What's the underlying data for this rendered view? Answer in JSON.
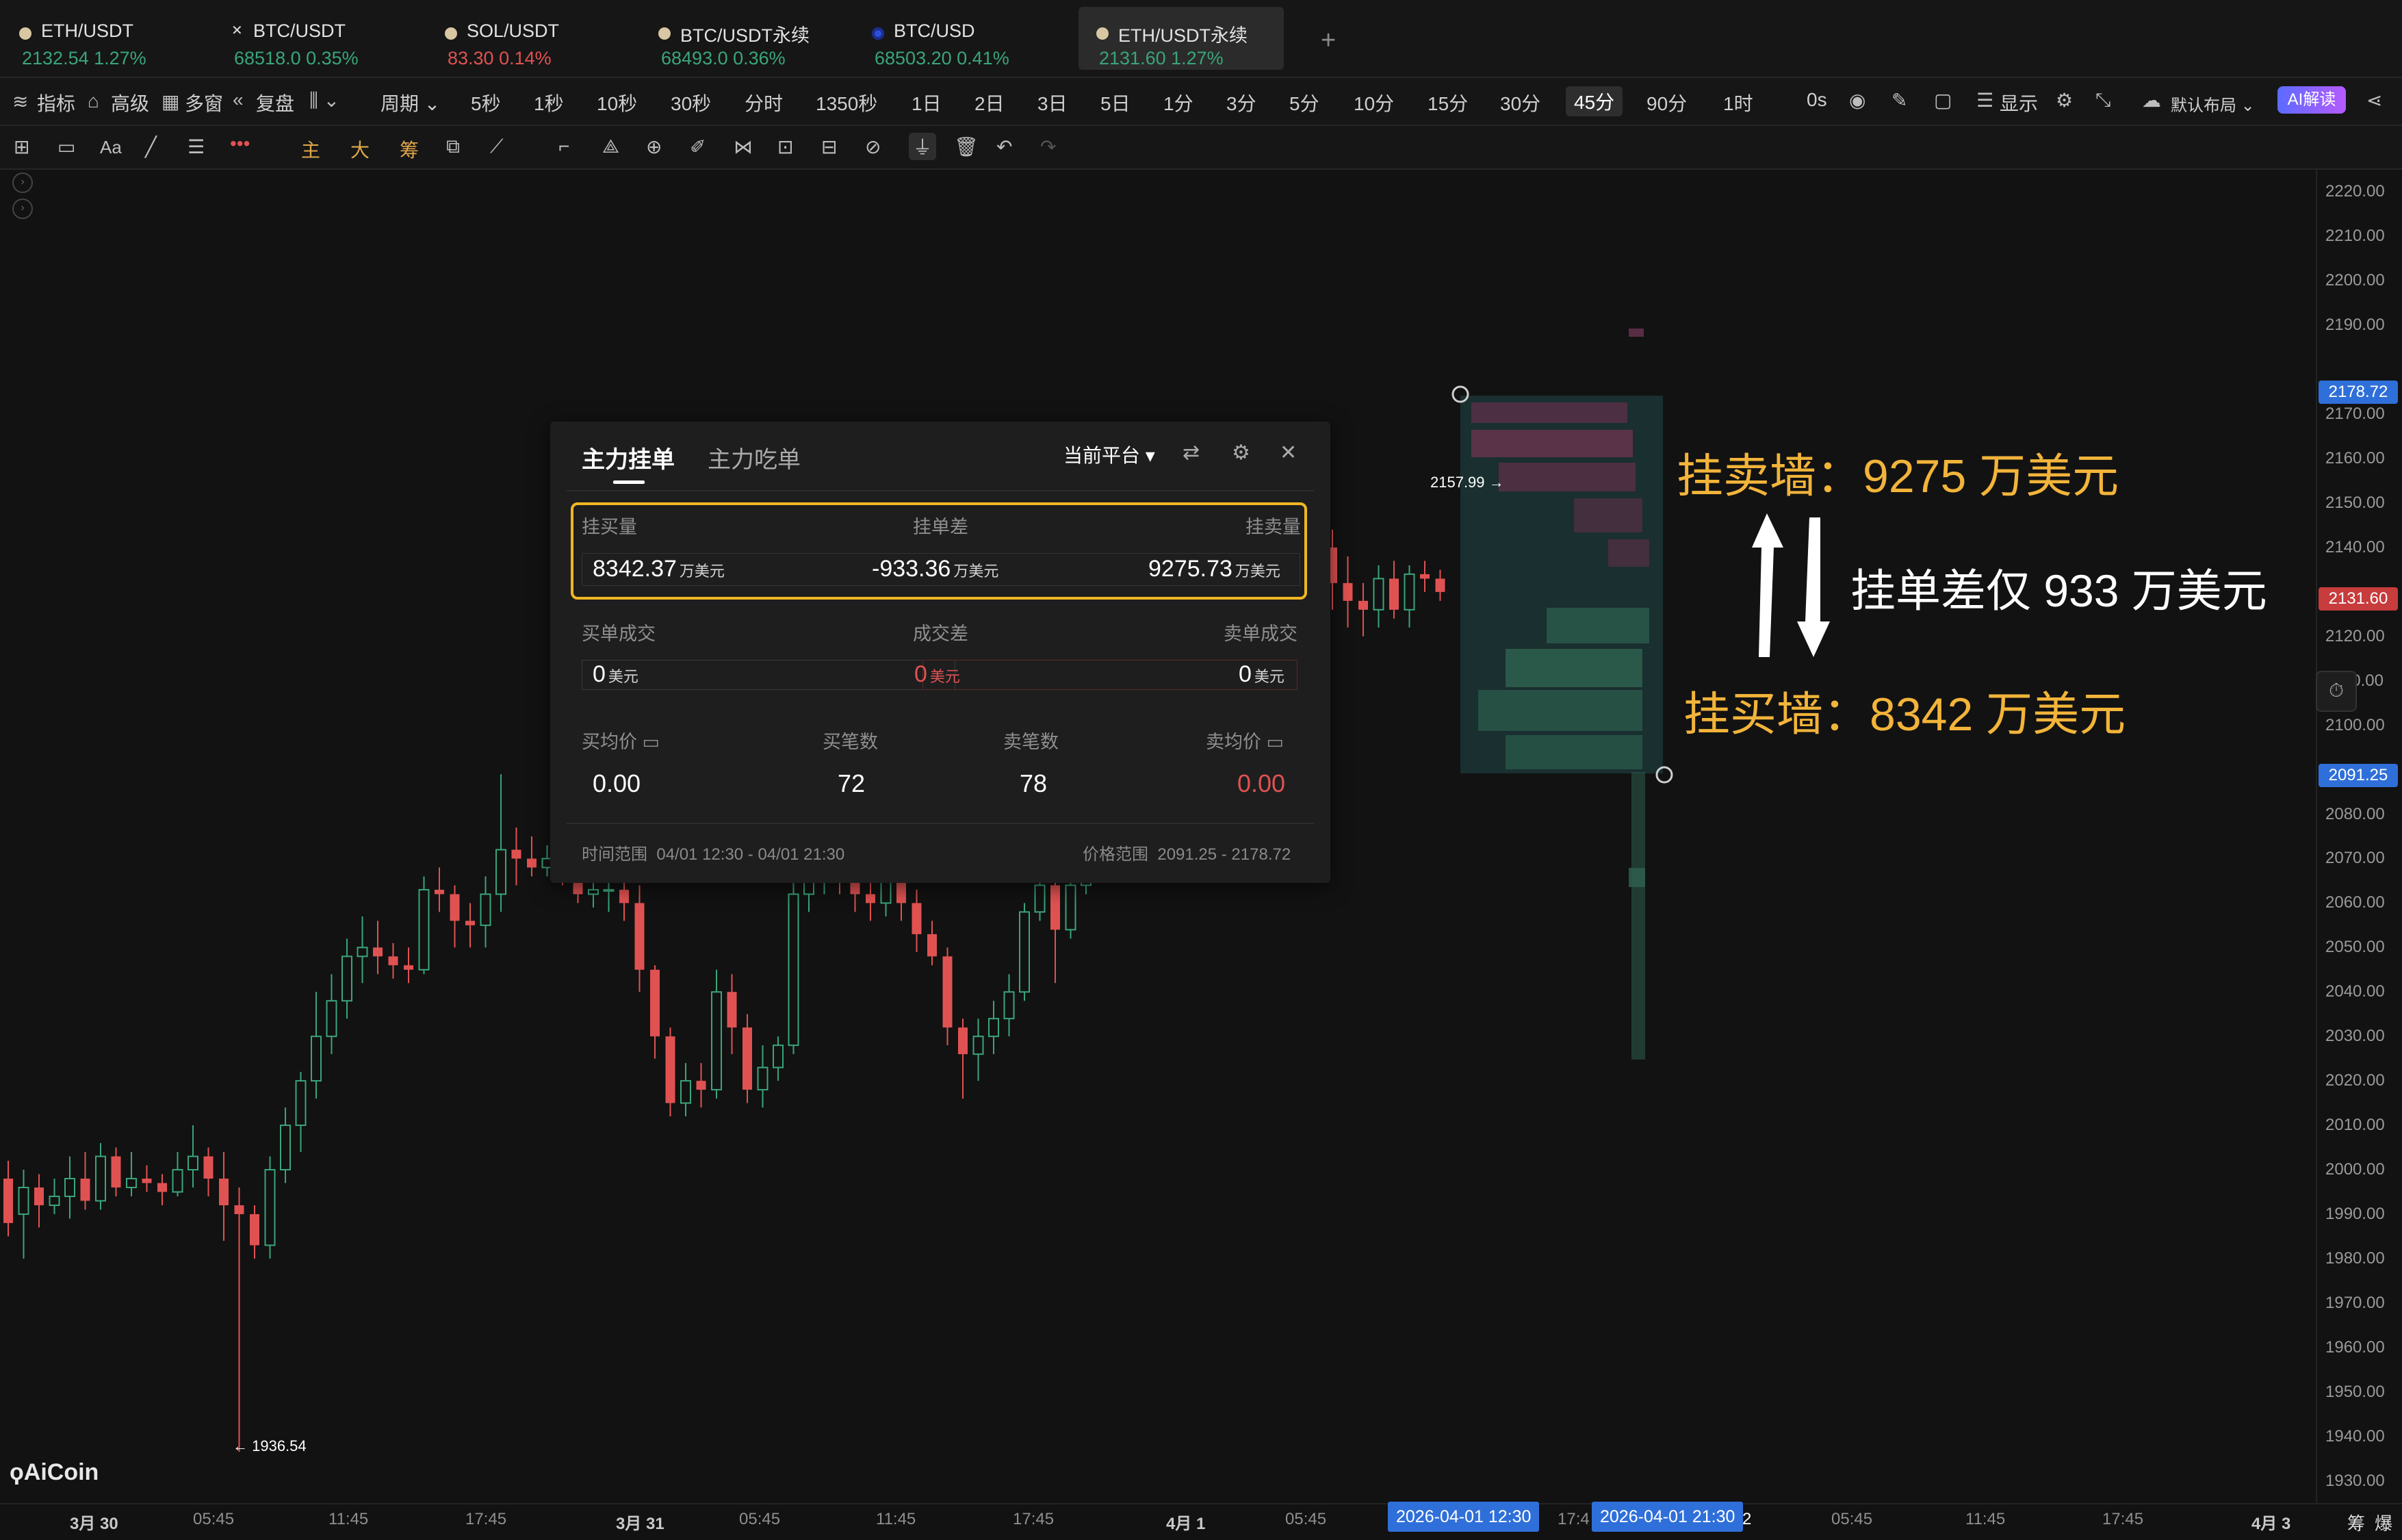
{
  "tabs": [
    {
      "name": "ETH/USDT",
      "price": "2132.54",
      "change": "1.27%",
      "dir": "up"
    },
    {
      "name": "BTC/USDT",
      "price": "68518.0",
      "change": "0.35%",
      "dir": "up"
    },
    {
      "name": "SOL/USDT",
      "price": "83.30",
      "change": "0.14%",
      "dir": "down"
    },
    {
      "name": "BTC/USDT永续",
      "price": "68493.0",
      "change": "0.36%",
      "dir": "up"
    },
    {
      "name": "BTC/USD",
      "price": "68503.20",
      "change": "0.41%",
      "dir": "up"
    },
    {
      "name": "ETH/USDT永续",
      "price": "2131.60",
      "change": "1.27%",
      "dir": "up"
    }
  ],
  "toolbar1": {
    "indicators": "指标",
    "advanced": "高级",
    "multi_window": "多窗",
    "replay": "复盘",
    "period": "周期",
    "intervals": [
      "5秒",
      "1秒",
      "10秒",
      "30秒",
      "分时",
      "1350秒",
      "1日",
      "2日",
      "3日",
      "5日",
      "1分",
      "3分",
      "5分",
      "10分",
      "15分",
      "30分",
      "45分",
      "90分",
      "1时"
    ],
    "selected_interval": "45分",
    "countdown": "0s",
    "display": "显示",
    "layout": "默认布局",
    "ai": "AI解读"
  },
  "toolbar2": {
    "text_aa": "Aa",
    "main": "主",
    "big": "大",
    "chip": "筹"
  },
  "panel": {
    "tab_orders": "主力挂单",
    "tab_eaten": "主力吃单",
    "platform": "当前平台",
    "bid_volume_label": "挂买量",
    "diff_label": "挂单差",
    "ask_volume_label": "挂卖量",
    "bid_volume": "8342.37",
    "diff": "-933.36",
    "ask_volume": "9275.73",
    "unit_wan": "万美元",
    "buy_fill_label": "买单成交",
    "fill_diff_label": "成交差",
    "sell_fill_label": "卖单成交",
    "buy_fill": "0",
    "fill_diff": "0",
    "sell_fill": "0",
    "unit_usd": "美元",
    "buy_avg_label": "买均价",
    "buy_count_label": "买笔数",
    "sell_count_label": "卖笔数",
    "sell_avg_label": "卖均价",
    "buy_avg": "0.00",
    "buy_count": "72",
    "sell_count": "78",
    "sell_avg": "0.00",
    "time_range_label": "时间范围",
    "time_range": "04/01 12:30 - 04/01 21:30",
    "price_range_label": "价格范围",
    "price_range": "2091.25 - 2178.72"
  },
  "annotations": {
    "sell_wall": "挂卖墙：9275 万美元",
    "diff_note": "挂单差仅 933 万美元",
    "buy_wall": "挂买墙：8342 万美元"
  },
  "chart_marks": {
    "high_marker": "2157.99 →",
    "low_marker": "← 1936.54",
    "logo": "AiCoin"
  },
  "price_axis": {
    "labels": [
      "2220.00",
      "2210.00",
      "2200.00",
      "2190.00",
      "2170.00",
      "2160.00",
      "2150.00",
      "2140.00",
      "2120.00",
      "2110.00",
      "2100.00",
      "2080.00",
      "2070.00",
      "2060.00",
      "2050.00",
      "2040.00",
      "2030.00",
      "2020.00",
      "2010.00",
      "2000.00",
      "1990.00",
      "1980.00",
      "1970.00",
      "1960.00",
      "1950.00",
      "1940.00",
      "1930.00"
    ],
    "tag_top": "2178.72",
    "tag_current": "2131.60",
    "tag_bottom": "2091.25"
  },
  "time_axis": {
    "labels": [
      "3月 30",
      "05:45",
      "11:45",
      "17:45",
      "3月 31",
      "05:45",
      "11:45",
      "17:45",
      "4月 1",
      "05:45",
      "17:4",
      "2",
      "05:45",
      "11:45",
      "17:45",
      "4月 3"
    ],
    "range_start": "2026-04-01 12:30",
    "range_end": "2026-04-01 21:30",
    "corner_chip": "筹",
    "corner_burst": "爆"
  },
  "colors": {
    "up": "#3aa57a",
    "down": "#e05252",
    "highlight": "#f0b723",
    "annotation": "#f2b43a",
    "accent": "#2f6fd9"
  },
  "chart_data": {
    "type": "candlestick",
    "y_range": [
      1925,
      2225
    ],
    "candles": [
      [
        1998,
        1988,
        2002,
        1985
      ],
      [
        1990,
        1996,
        2000,
        1980
      ],
      [
        1996,
        1992,
        1999,
        1987
      ],
      [
        1992,
        1994,
        1998,
        1990
      ],
      [
        1994,
        1998,
        2003,
        1989
      ],
      [
        1998,
        1993,
        2004,
        1991
      ],
      [
        1993,
        2003,
        2006,
        1991
      ],
      [
        2003,
        1996,
        2005,
        1994
      ],
      [
        1996,
        1998,
        2004,
        1994
      ],
      [
        1998,
        1997,
        2001,
        1995
      ],
      [
        1997,
        1995,
        1999,
        1992
      ],
      [
        1995,
        2000,
        2004,
        1994
      ],
      [
        2000,
        2003,
        2010,
        1996
      ],
      [
        2003,
        1998,
        2005,
        1994
      ],
      [
        1998,
        1992,
        2004,
        1984
      ],
      [
        1992,
        1990,
        1996,
        1936.54
      ],
      [
        1990,
        1983,
        1992,
        1980
      ],
      [
        1983,
        2000,
        2003,
        1980
      ],
      [
        2000,
        2010,
        2014,
        1997
      ],
      [
        2010,
        2020,
        2022,
        2004
      ],
      [
        2020,
        2030,
        2040,
        2016
      ],
      [
        2030,
        2038,
        2044,
        2026
      ],
      [
        2038,
        2048,
        2052,
        2034
      ],
      [
        2048,
        2050,
        2057,
        2042
      ],
      [
        2050,
        2048,
        2056,
        2044
      ],
      [
        2048,
        2046,
        2051,
        2043
      ],
      [
        2046,
        2045,
        2050,
        2042
      ],
      [
        2045,
        2063,
        2066,
        2044
      ],
      [
        2063,
        2062,
        2068,
        2058
      ],
      [
        2062,
        2056,
        2064,
        2050
      ],
      [
        2056,
        2055,
        2060,
        2050
      ],
      [
        2055,
        2062,
        2066,
        2050
      ],
      [
        2062,
        2072,
        2089,
        2058
      ],
      [
        2072,
        2070,
        2077,
        2064
      ],
      [
        2070,
        2068,
        2075,
        2066
      ],
      [
        2068,
        2070,
        2073,
        2066
      ],
      [
        2070,
        2069,
        2073,
        2064
      ],
      [
        2069,
        2062,
        2072,
        2060
      ],
      [
        2062,
        2063,
        2070,
        2059
      ],
      [
        2063,
        2063,
        2066,
        2058
      ],
      [
        2063,
        2060,
        2067,
        2056
      ],
      [
        2060,
        2045,
        2064,
        2040
      ],
      [
        2045,
        2030,
        2046,
        2025
      ],
      [
        2030,
        2015,
        2032,
        2012
      ],
      [
        2015,
        2020,
        2024,
        2012
      ],
      [
        2020,
        2018,
        2024,
        2014
      ],
      [
        2018,
        2040,
        2045,
        2016
      ],
      [
        2040,
        2032,
        2044,
        2026
      ],
      [
        2032,
        2018,
        2035,
        2015
      ],
      [
        2018,
        2023,
        2028,
        2014
      ],
      [
        2023,
        2028,
        2030,
        2020
      ],
      [
        2028,
        2062,
        2066,
        2026
      ],
      [
        2062,
        2068,
        2072,
        2058
      ],
      [
        2068,
        2070,
        2074,
        2062
      ],
      [
        2070,
        2065,
        2072,
        2062
      ],
      [
        2065,
        2062,
        2068,
        2058
      ],
      [
        2062,
        2060,
        2066,
        2056
      ],
      [
        2060,
        2066,
        2069,
        2057
      ],
      [
        2066,
        2060,
        2069,
        2056
      ],
      [
        2060,
        2053,
        2063,
        2049
      ],
      [
        2053,
        2048,
        2056,
        2046
      ],
      [
        2048,
        2032,
        2050,
        2028
      ],
      [
        2032,
        2026,
        2034,
        2016
      ],
      [
        2026,
        2030,
        2034,
        2020
      ],
      [
        2030,
        2034,
        2038,
        2026
      ],
      [
        2034,
        2040,
        2044,
        2030
      ],
      [
        2040,
        2058,
        2060,
        2038
      ],
      [
        2058,
        2064,
        2070,
        2056
      ],
      [
        2064,
        2054,
        2076,
        2042
      ],
      [
        2054,
        2064,
        2066,
        2052
      ],
      [
        2064,
        2074,
        2078,
        2062
      ],
      [
        2074,
        2086,
        2092,
        2070
      ],
      [
        2086,
        2094,
        2112,
        2084
      ],
      [
        2094,
        2104,
        2108,
        2090
      ],
      [
        2104,
        2098,
        2108,
        2094
      ],
      [
        2098,
        2092,
        2102,
        2084
      ],
      [
        2092,
        2086,
        2096,
        2083
      ],
      [
        2086,
        2082,
        2090,
        2078
      ],
      [
        2082,
        2094,
        2098,
        2080
      ],
      [
        2094,
        2104,
        2108,
        2090
      ],
      [
        2104,
        2108,
        2116,
        2098
      ],
      [
        2108,
        2116,
        2120,
        2102
      ],
      [
        2116,
        2126,
        2130,
        2112
      ],
      [
        2126,
        2152,
        2156,
        2124
      ],
      [
        2152,
        2156,
        2158,
        2146
      ],
      [
        2156,
        2140,
        2158,
        2134
      ],
      [
        2140,
        2132,
        2144,
        2126
      ],
      [
        2132,
        2128,
        2138,
        2122
      ],
      [
        2128,
        2126,
        2132,
        2120
      ],
      [
        2126,
        2133,
        2136,
        2122
      ],
      [
        2133,
        2126,
        2137,
        2124
      ],
      [
        2126,
        2134,
        2136,
        2122
      ],
      [
        2134,
        2133,
        2137,
        2130
      ],
      [
        2133,
        2130,
        2135,
        2128
      ]
    ]
  }
}
